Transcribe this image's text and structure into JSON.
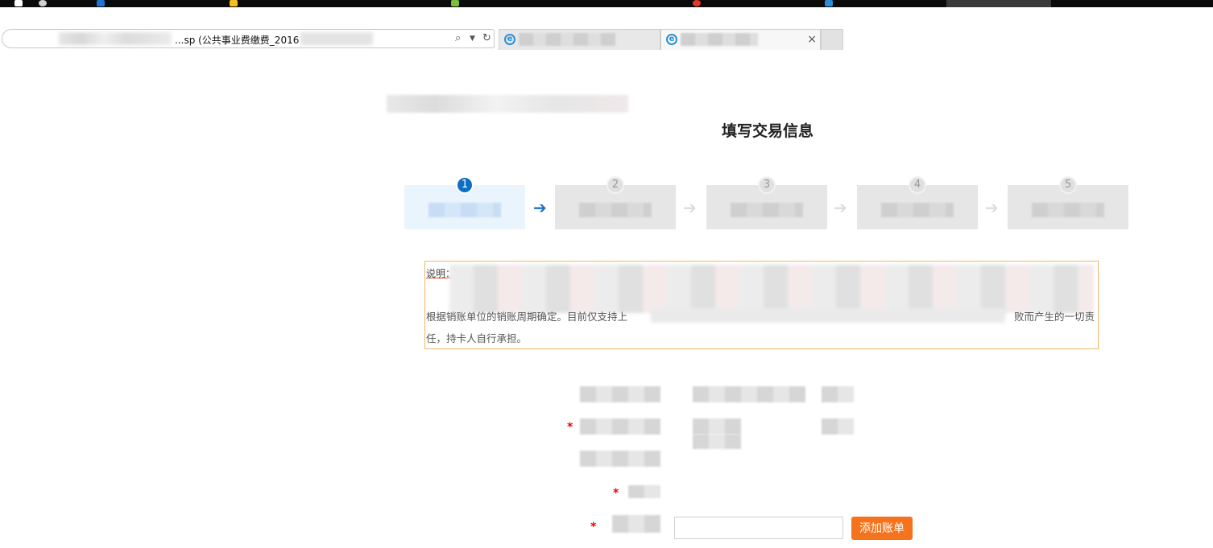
{
  "browser": {
    "address_text": "...sp (公共事业费缴费_2016",
    "search_icon": "search-icon",
    "refresh_icon": "refresh-icon",
    "close_tab_label": "×"
  },
  "page": {
    "title": "填写交易信息"
  },
  "steps": [
    {
      "number": "1",
      "active": true
    },
    {
      "number": "2",
      "active": false
    },
    {
      "number": "3",
      "active": false
    },
    {
      "number": "4",
      "active": false
    },
    {
      "number": "5",
      "active": false
    }
  ],
  "step_arrow": "➔",
  "notice": {
    "label": "说明：",
    "line3_start": "根据销账单位的销账周期确定。目前仅支持上",
    "line3_end": "败而产生的一切责",
    "line4": "任，持卡人自行承担。"
  },
  "form": {
    "required_mark": "*",
    "add_button_label": "添加账单",
    "input_value": ""
  },
  "colors": {
    "accent_blue": "#0b6fc4",
    "button_orange": "#f5731c",
    "notice_border": "#f0b56b",
    "required_red": "#e00000"
  }
}
